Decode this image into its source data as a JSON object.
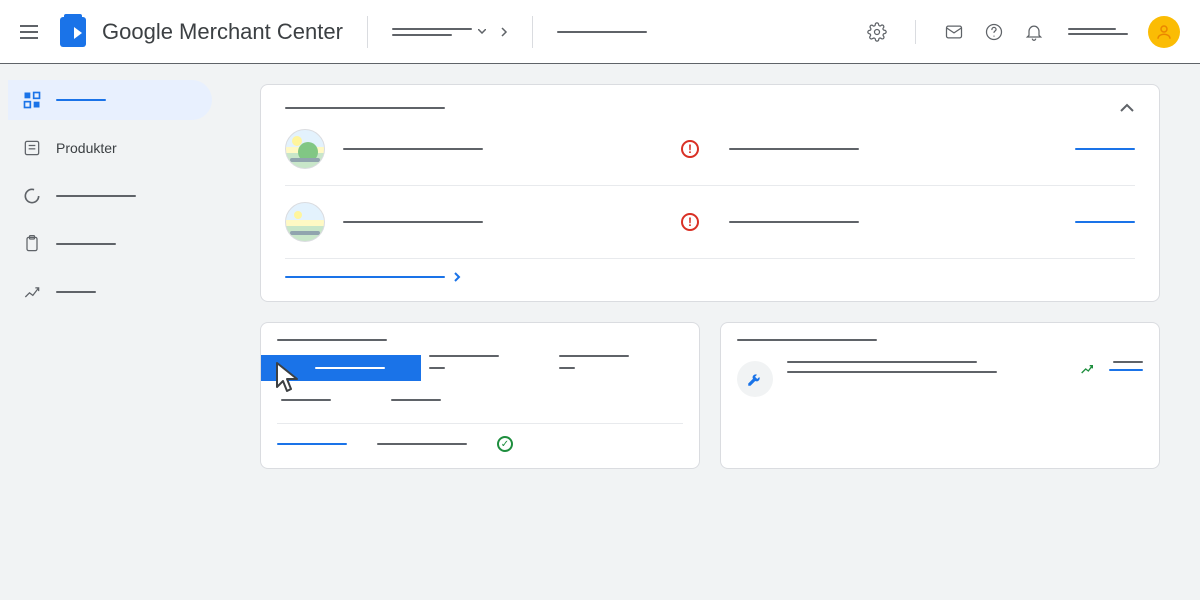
{
  "header": {
    "app_title": "Google Merchant Center",
    "icons": {
      "settings": "gear-icon",
      "mail": "mail-icon",
      "help": "help-icon",
      "notifications": "bell-icon"
    }
  },
  "sidebar": {
    "items": [
      {
        "label": "",
        "icon": "dashboard-icon",
        "active": true
      },
      {
        "label": "Produkter",
        "icon": "list-icon",
        "active": false
      },
      {
        "label": "",
        "icon": "circle-progress-icon",
        "active": false
      },
      {
        "label": "",
        "icon": "clipboard-icon",
        "active": false
      },
      {
        "label": "",
        "icon": "trend-icon",
        "active": false
      }
    ]
  },
  "colors": {
    "primary": "#1a73e8",
    "error": "#d93025",
    "success": "#1e8e3e",
    "accent": "#fbbc04",
    "text": "#3c4043"
  }
}
